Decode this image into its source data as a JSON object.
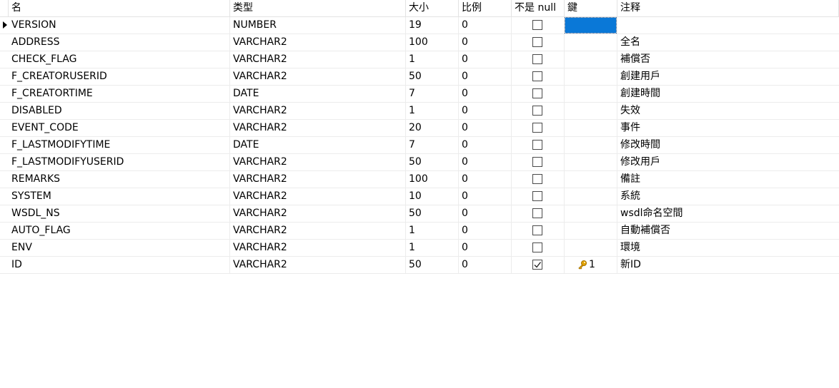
{
  "columns": {
    "name": "名",
    "type": "类型",
    "size": "大小",
    "scale": "比例",
    "not_null": "不是 null",
    "key": "鍵",
    "comment": "注释"
  },
  "rows": [
    {
      "name": "VERSION",
      "type": "NUMBER",
      "size": "19",
      "scale": "0",
      "not_null": false,
      "key": "",
      "comment": ""
    },
    {
      "name": "ADDRESS",
      "type": "VARCHAR2",
      "size": "100",
      "scale": "0",
      "not_null": false,
      "key": "",
      "comment": "全名"
    },
    {
      "name": "CHECK_FLAG",
      "type": "VARCHAR2",
      "size": "1",
      "scale": "0",
      "not_null": false,
      "key": "",
      "comment": "補償否"
    },
    {
      "name": "F_CREATORUSERID",
      "type": "VARCHAR2",
      "size": "50",
      "scale": "0",
      "not_null": false,
      "key": "",
      "comment": "創建用戶"
    },
    {
      "name": "F_CREATORTIME",
      "type": "DATE",
      "size": "7",
      "scale": "0",
      "not_null": false,
      "key": "",
      "comment": "創建時間"
    },
    {
      "name": "DISABLED",
      "type": "VARCHAR2",
      "size": "1",
      "scale": "0",
      "not_null": false,
      "key": "",
      "comment": "失效"
    },
    {
      "name": "EVENT_CODE",
      "type": "VARCHAR2",
      "size": "20",
      "scale": "0",
      "not_null": false,
      "key": "",
      "comment": "事件"
    },
    {
      "name": "F_LASTMODIFYTIME",
      "type": "DATE",
      "size": "7",
      "scale": "0",
      "not_null": false,
      "key": "",
      "comment": "修改時間"
    },
    {
      "name": "F_LASTMODIFYUSERID",
      "type": "VARCHAR2",
      "size": "50",
      "scale": "0",
      "not_null": false,
      "key": "",
      "comment": "修改用戶"
    },
    {
      "name": "REMARKS",
      "type": "VARCHAR2",
      "size": "100",
      "scale": "0",
      "not_null": false,
      "key": "",
      "comment": "備註"
    },
    {
      "name": "SYSTEM",
      "type": "VARCHAR2",
      "size": "10",
      "scale": "0",
      "not_null": false,
      "key": "",
      "comment": "系統"
    },
    {
      "name": "WSDL_NS",
      "type": "VARCHAR2",
      "size": "50",
      "scale": "0",
      "not_null": false,
      "key": "",
      "comment": "wsdl命名空間"
    },
    {
      "name": "AUTO_FLAG",
      "type": "VARCHAR2",
      "size": "1",
      "scale": "0",
      "not_null": false,
      "key": "",
      "comment": "自動補償否"
    },
    {
      "name": "ENV",
      "type": "VARCHAR2",
      "size": "1",
      "scale": "0",
      "not_null": false,
      "key": "",
      "comment": "環境"
    },
    {
      "name": "ID",
      "type": "VARCHAR2",
      "size": "50",
      "scale": "0",
      "not_null": true,
      "key": "1",
      "comment": "新ID"
    }
  ],
  "current_row": 0,
  "icons": {
    "row_indicator": "current-row-indicator-icon",
    "primary_key": "primary-key-icon",
    "checkmark": "checkmark-icon"
  },
  "colors": {
    "selection": "#0a78d7",
    "key_icon": "#e0a000",
    "grid_line": "#ececec"
  }
}
